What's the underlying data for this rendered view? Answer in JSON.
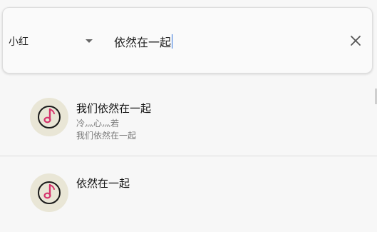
{
  "search": {
    "source": "小红",
    "query": "依然在一起"
  },
  "icons": {
    "dropdown": "chevron-down-icon",
    "clear": "close-icon",
    "cover": "music-note-icon"
  },
  "colors": {
    "avatar_bg": "#e9e6d6",
    "note_accent": "#d6336c"
  },
  "results": [
    {
      "title": "我们依然在一起",
      "artist": "冷灬心灬若",
      "album": "我们依然在一起"
    },
    {
      "title": "依然在一起",
      "artist": "",
      "album": ""
    }
  ]
}
